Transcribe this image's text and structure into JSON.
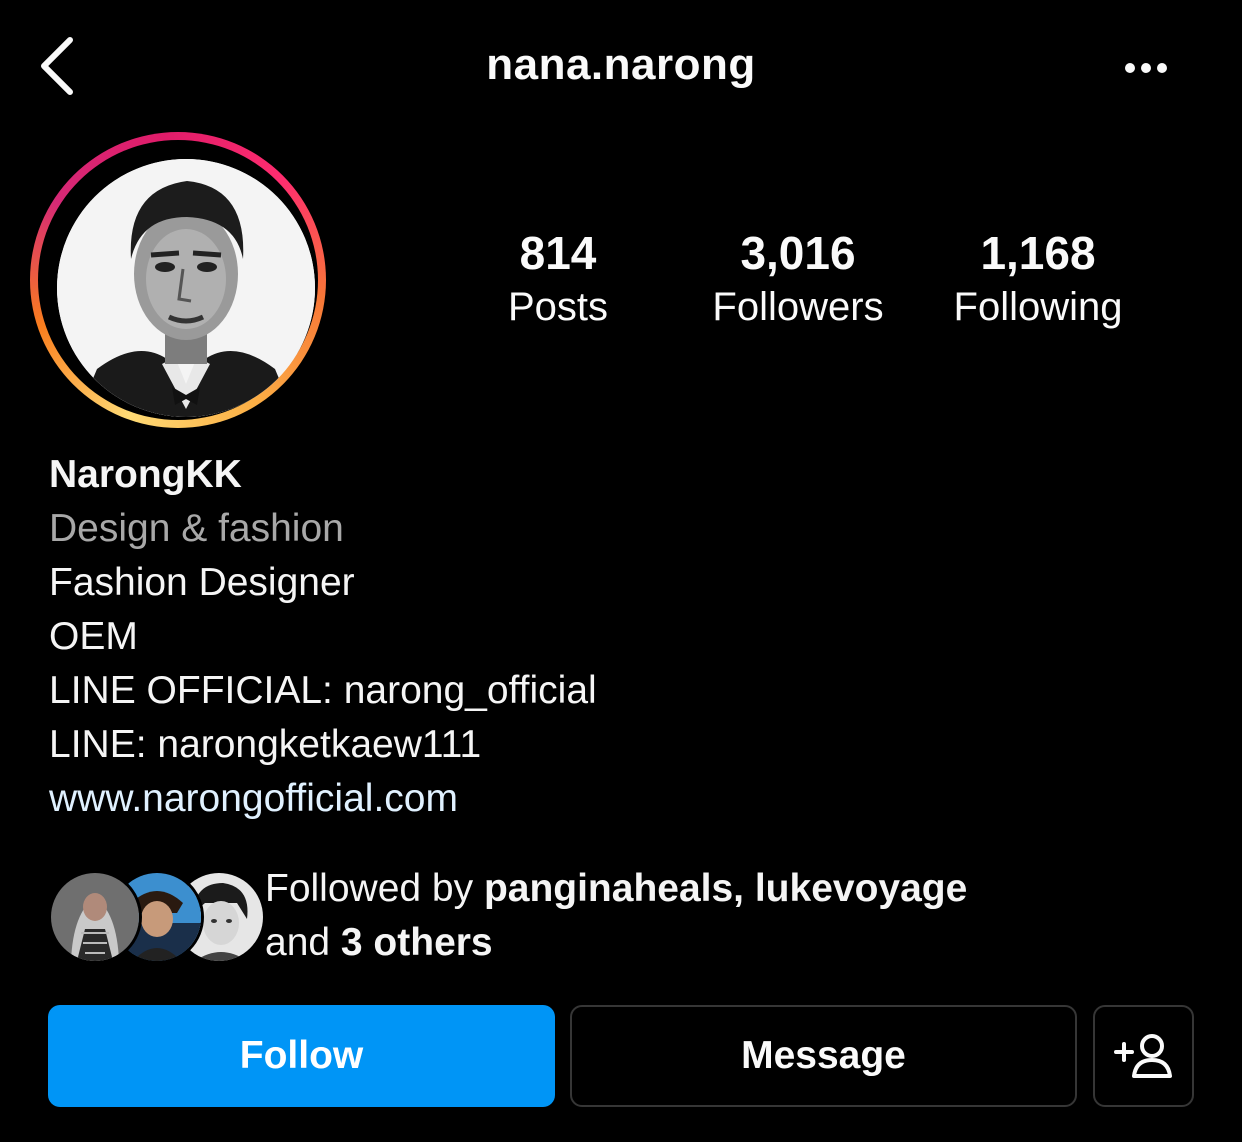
{
  "header": {
    "username": "nana.narong",
    "back_icon": "chevron-left-icon",
    "more_icon": "more-horizontal-icon"
  },
  "profile": {
    "avatar_ring_colors": [
      "#feda75",
      "#fa7e1e",
      "#d62976",
      "#e01c6a"
    ],
    "stats": [
      {
        "value": "814",
        "label": "Posts"
      },
      {
        "value": "3,016",
        "label": "Followers"
      },
      {
        "value": "1,168",
        "label": "Following"
      }
    ]
  },
  "bio": {
    "display_name": "NarongKK",
    "category": "Design & fashion",
    "lines": [
      "Fashion Designer",
      "OEM",
      "LINE OFFICIAL: narong_official",
      "LINE: narongketkaew111"
    ],
    "website": "www.narongofficial.com"
  },
  "followed_by": {
    "prefix": "Followed by ",
    "users": "panginaheals, lukevoyage",
    "and_text": "and ",
    "others": "3 others"
  },
  "actions": {
    "follow_label": "Follow",
    "message_label": "Message",
    "suggest_icon": "add-person-icon",
    "follow_color": "#0095f6"
  }
}
